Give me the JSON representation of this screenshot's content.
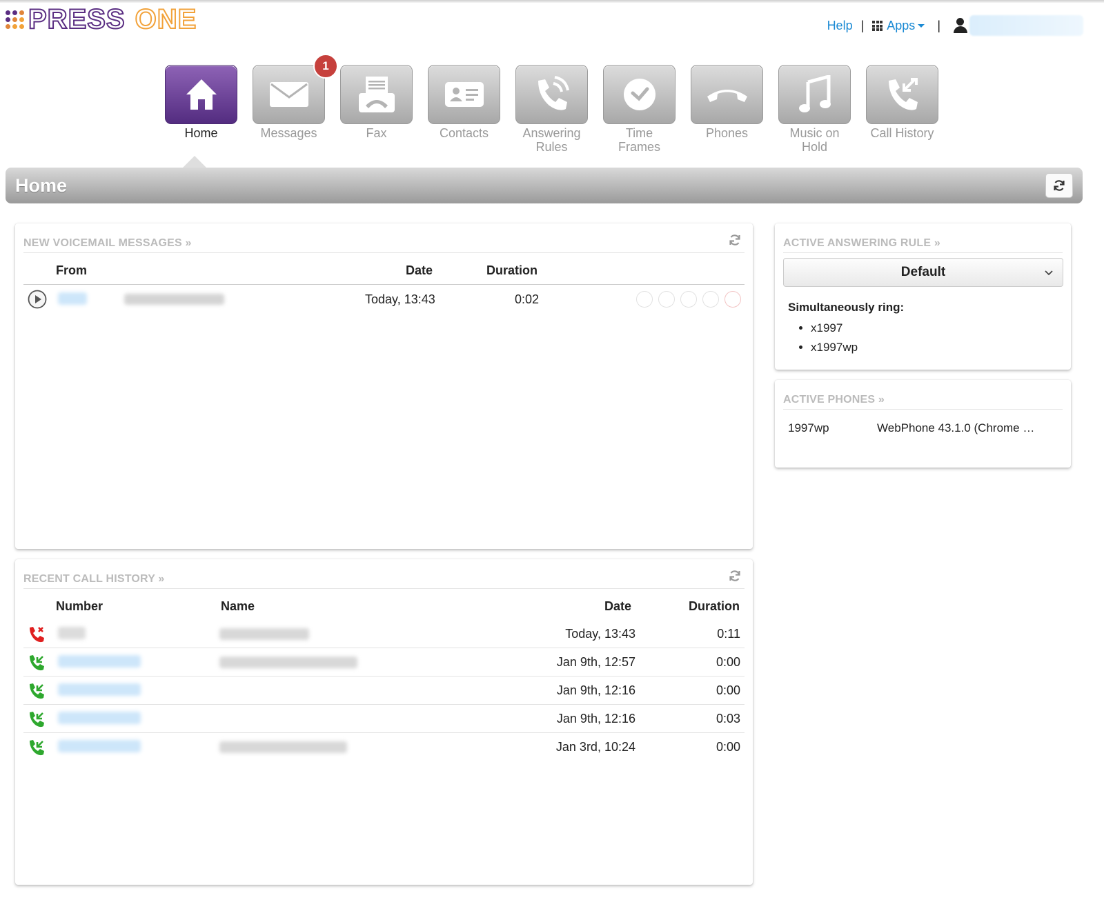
{
  "brand": {
    "word1": "PRESS",
    "word2": "ONE",
    "dot_colors": [
      "#5a2d82",
      "#5a2d82",
      "#e0853a",
      "#5a2d82",
      "#e0853a",
      "#f2a23a",
      "#e0853a",
      "#f2a23a",
      "#f2a23a"
    ]
  },
  "header": {
    "help": "Help",
    "apps": "Apps"
  },
  "nav": [
    {
      "label": "Home",
      "icon": "home-icon",
      "active": true
    },
    {
      "label": "Messages",
      "icon": "envelope-icon",
      "badge": "1"
    },
    {
      "label": "Fax",
      "icon": "fax-icon"
    },
    {
      "label": "Contacts",
      "icon": "contact-card-icon"
    },
    {
      "label": "Answering Rules",
      "icon": "answering-rules-icon"
    },
    {
      "label": "Time Frames",
      "icon": "clock-icon"
    },
    {
      "label": "Phones",
      "icon": "handset-icon"
    },
    {
      "label": "Music on Hold",
      "icon": "music-note-icon"
    },
    {
      "label": "Call History",
      "icon": "call-history-icon"
    }
  ],
  "page_title": "Home",
  "voicemail": {
    "title": "NEW VOICEMAIL MESSAGES »",
    "columns": {
      "from": "From",
      "date": "Date",
      "duration": "Duration"
    },
    "rows": [
      {
        "date": "Today, 13:43",
        "duration": "0:02"
      }
    ]
  },
  "call_history": {
    "title": "RECENT CALL HISTORY »",
    "columns": {
      "number": "Number",
      "name": "Name",
      "date": "Date",
      "duration": "Duration"
    },
    "rows": [
      {
        "direction": "missed",
        "date": "Today, 13:43",
        "duration": "0:11"
      },
      {
        "direction": "answered",
        "date": "Jan 9th, 12:57",
        "duration": "0:00"
      },
      {
        "direction": "answered",
        "date": "Jan 9th, 12:16",
        "duration": "0:00"
      },
      {
        "direction": "answered",
        "date": "Jan 9th, 12:16",
        "duration": "0:03"
      },
      {
        "direction": "answered",
        "date": "Jan 3rd, 10:24",
        "duration": "0:00"
      }
    ]
  },
  "answering_rule": {
    "title": "ACTIVE ANSWERING RULE »",
    "selected": "Default",
    "ring_label": "Simultaneously ring:",
    "ring_targets": [
      "x1997",
      "x1997wp"
    ]
  },
  "active_phones": {
    "title": "ACTIVE PHONES »",
    "rows": [
      {
        "name": "1997wp",
        "device": "WebPhone 43.1.0 (Chrome …"
      }
    ]
  },
  "colors": {
    "accent_purple": "#5a2d82",
    "link_blue": "#1a8ad4",
    "missed_red": "#e02020",
    "answered_green": "#2ea82e",
    "badge_red": "#c6403c"
  }
}
